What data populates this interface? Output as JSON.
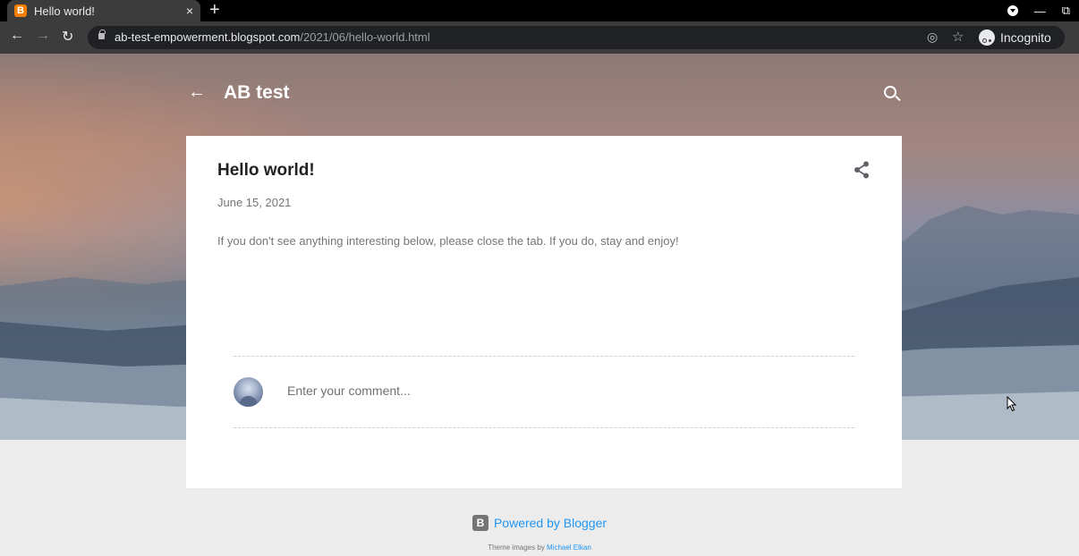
{
  "browser": {
    "tab_title": "Hello world!",
    "tab_favicon": "B",
    "new_tab_label": "+",
    "close_tab_label": "×",
    "url_host": "ab-test-empowerment.blogspot.com",
    "url_path": "/2021/06/hello-world.html",
    "incognito_label": "Incognito"
  },
  "blog": {
    "title": "AB test",
    "back_icon": "arrow-left-icon",
    "search_icon": "search-icon"
  },
  "post": {
    "title": "Hello world!",
    "date": "June 15, 2021",
    "body": "If you don't see anything interesting below, please close the tab. If you do, stay and enjoy!"
  },
  "comments": {
    "placeholder": "Enter your comment..."
  },
  "footer": {
    "powered_label": "Powered by Blogger",
    "theme_prefix": "Theme images by ",
    "theme_author": "Michael Elkan"
  },
  "colors": {
    "accent": "#2196f3",
    "favicon": "#f57d00",
    "title_text": "#212121",
    "muted_text": "#757575"
  }
}
